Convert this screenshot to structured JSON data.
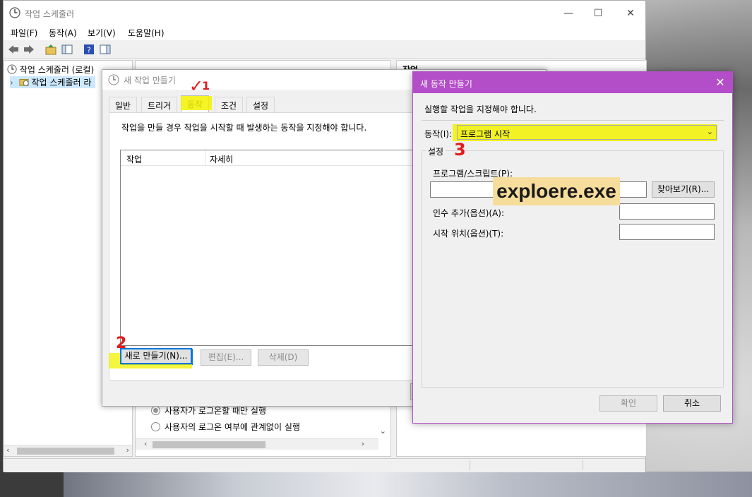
{
  "main_window": {
    "title": "작업 스케줄러",
    "menu": [
      "파일(F)",
      "동작(A)",
      "보기(V)",
      "도움말(H)"
    ],
    "tree": [
      {
        "label": "작업 스케줄러 (로컬)",
        "expander": ""
      },
      {
        "label": "작업 스케줄러 라",
        "expander": "›"
      }
    ],
    "right_pane_header": "작업"
  },
  "create_task": {
    "title": "새 작업 만들기",
    "tabs": [
      "일반",
      "트리거",
      "동작",
      "조건",
      "설정"
    ],
    "active_tab": "동작",
    "description": "작업을 만들 경우 작업을 시작할 때 발생하는 동작을 지정해야 합니다.",
    "columns": [
      "작업",
      "자세히"
    ],
    "buttons": {
      "new": "새로 만들기(N)...",
      "edit": "편집(E)...",
      "delete": "삭제(D)"
    }
  },
  "background_options": {
    "radio1": "사용자가 로그온할 때만 실행",
    "radio2": "사용자의 로그온 여부에 관계없이 실행"
  },
  "new_action": {
    "title": "새 동작 만들기",
    "instruction": "실행할 작업을 지정해야 합니다.",
    "action_label": "동작(I):",
    "action_value": "프로그램 시작",
    "settings_label": "설정",
    "program_label": "프로그램/스크립트(P):",
    "program_value": "",
    "browse": "찾아보기(R)...",
    "args_label": "인수 추가(옵션)(A):",
    "start_label": "시작 위치(옵션)(T):",
    "ok": "확인",
    "cancel": "취소"
  },
  "annotations": {
    "step1": "1",
    "step2": "2",
    "step3": "3",
    "callout": "exploere.exe",
    "highlight_color": "#f2f200",
    "marker_color": "#e41a1a"
  }
}
